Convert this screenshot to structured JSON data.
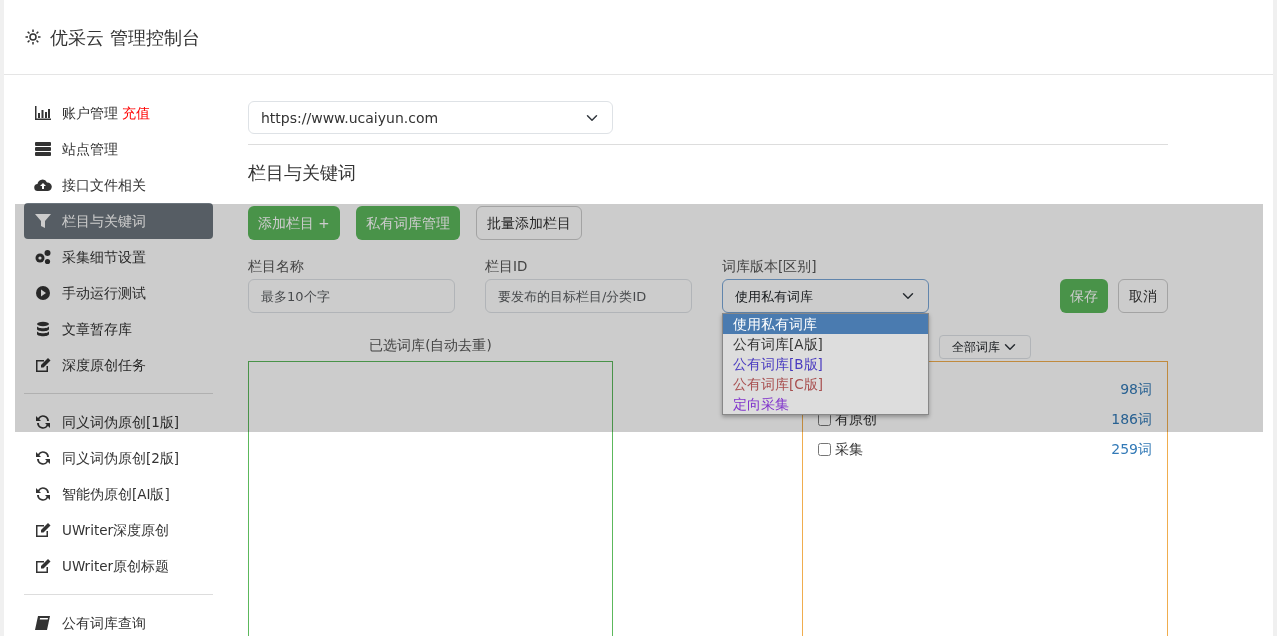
{
  "header": {
    "title": "优采云 管理控制台"
  },
  "sidebar": {
    "items": [
      {
        "kind": "chart",
        "label": "账户管理",
        "badge": "充值",
        "selected": false,
        "divider_after": false
      },
      {
        "kind": "server",
        "label": "站点管理",
        "selected": false,
        "divider_after": false
      },
      {
        "kind": "cloud",
        "label": "接口文件相关",
        "selected": false,
        "divider_after": false
      },
      {
        "kind": "filter",
        "label": "栏目与关键词",
        "selected": true,
        "divider_after": false
      },
      {
        "kind": "gears",
        "label": "采集细节设置",
        "selected": false,
        "divider_after": false
      },
      {
        "kind": "play",
        "label": "手动运行测试",
        "selected": false,
        "divider_after": false
      },
      {
        "kind": "database",
        "label": "文章暂存库",
        "selected": false,
        "divider_after": false
      },
      {
        "kind": "edit",
        "label": "深度原创任务",
        "selected": false,
        "divider_after": true
      },
      {
        "kind": "refresh",
        "label": "同义词伪原创[1版]",
        "selected": false,
        "divider_after": false
      },
      {
        "kind": "refresh",
        "label": "同义词伪原创[2版]",
        "selected": false,
        "divider_after": false
      },
      {
        "kind": "refresh",
        "label": "智能伪原创[AI版]",
        "selected": false,
        "divider_after": false
      },
      {
        "kind": "edit",
        "label": "UWriter深度原创",
        "selected": false,
        "divider_after": false
      },
      {
        "kind": "edit",
        "label": "UWriter原创标题",
        "selected": false,
        "divider_after": true
      },
      {
        "kind": "book",
        "label": "公有词库查询",
        "selected": false,
        "divider_after": false
      }
    ]
  },
  "site_select": {
    "value": "https://www.ucaiyun.com"
  },
  "section_title": "栏目与关键词",
  "toolbar": [
    {
      "kind": "primary",
      "label": "添加栏目 +"
    },
    {
      "kind": "primary",
      "label": "私有词库管理"
    },
    {
      "kind": "outline",
      "label": "批量添加栏目"
    }
  ],
  "fields": [
    {
      "label": "栏目名称",
      "placeholder": "最多10个字"
    },
    {
      "label": "栏目ID",
      "placeholder": "要发布的目标栏目/分类ID"
    }
  ],
  "version_select": {
    "label": "词库版本[区别]",
    "value": "使用私有词库",
    "options": [
      {
        "label": "使用私有词库",
        "selected": true
      },
      {
        "label": "公有词库[A版]",
        "selected": false,
        "color": "#333333"
      },
      {
        "label": "公有词库[B版]",
        "selected": false,
        "color": "#4a3bc0"
      },
      {
        "label": "公有词库[C版]",
        "selected": false,
        "color": "#a85050"
      },
      {
        "label": "定向采集",
        "selected": false,
        "color": "#8033cc"
      }
    ]
  },
  "actions": [
    {
      "kind": "primary",
      "label": "保存"
    },
    {
      "kind": "outline",
      "label": "取消"
    }
  ],
  "selected_panel": {
    "title": "已选词库(自动去重)"
  },
  "library_panel": {
    "filter": "全部词库",
    "rows": [
      {
        "count": "98词"
      },
      {
        "label": "有原创",
        "checked": false,
        "count": "186词"
      },
      {
        "label": "采集",
        "checked": false,
        "count": "259词"
      }
    ]
  }
}
